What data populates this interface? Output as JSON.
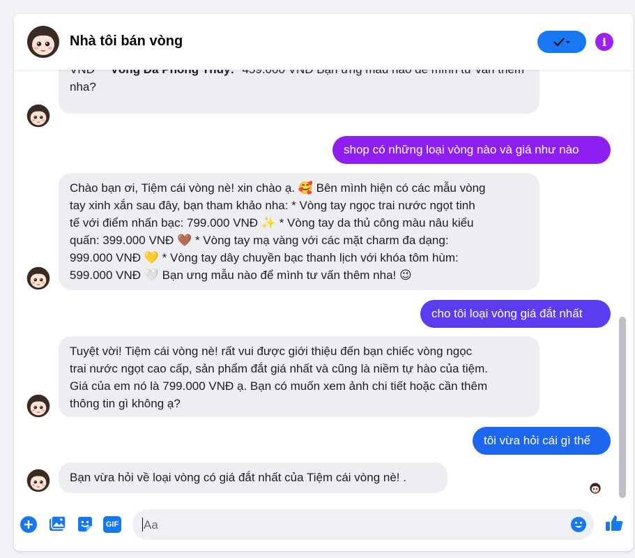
{
  "header": {
    "title": "Nhà tôi bán vòng"
  },
  "messages": [
    {
      "role": "bot",
      "parts": [
        "VNĐ *   ",
        "*Vòng Đá Phong Thủy:*",
        " 459.000 VNĐ  Bạn ưng mẫu nào để mình tư vấn thêm nha?"
      ]
    },
    {
      "role": "user",
      "text": "shop có những loại vòng nào và giá như nào"
    },
    {
      "role": "bot",
      "lines": [
        "Chào bạn ơi, Tiệm cái vòng nè! xin chào ạ. 🥰 Bên mình hiện có các mẫu vòng",
        "tay xinh xắn sau đây, bạn tham khảo nha:  *   Vòng tay ngọc trai nước ngọt tinh",
        "tế với điểm nhấn bạc: 799.000 VNĐ ✨ *   Vòng tay da thủ công màu nâu kiểu",
        "quấn: 399.000 VNĐ 🤎 *   Vòng tay mạ vàng với các mặt charm đa dạng:",
        "999.000 VNĐ 💛 *   Vòng tay dây chuyền bạc thanh lịch với khóa tôm hùm:",
        "599.000 VNĐ 🤍  Bạn ưng mẫu nào để mình tư vấn thêm nha! 😉"
      ]
    },
    {
      "role": "user",
      "text": "cho tôi loại vòng giá đắt nhất"
    },
    {
      "role": "bot",
      "lines": [
        "Tuyệt vời!  Tiệm cái vòng nè!  rất vui được giới thiệu đến bạn chiếc vòng ngọc",
        "trai nước ngọt cao cấp, sản phẩm đắt giá nhất và cũng là niềm tự hào của tiệm.",
        "Giá của em nó là 799.000 VNĐ ạ. Bạn có muốn xem ảnh chi tiết hoặc cần thêm",
        "thông tin gì không ạ?"
      ]
    },
    {
      "role": "user",
      "text": "tôi vừa hỏi cái gì thế"
    },
    {
      "role": "bot",
      "text": "Bạn vừa hỏi về loại vòng có giá đắt nhất của  Tiệm cái vòng nè! ."
    }
  ],
  "composer": {
    "placeholder": "Aa",
    "gif_label": "GIF",
    "icons": [
      "plus-icon",
      "image-icon",
      "sticker-icon",
      "gif-icon",
      "emoji-icon",
      "thumbs-up-icon"
    ]
  },
  "header_icons": [
    "checkmark-dropdown-icon",
    "info-icon"
  ],
  "colors": {
    "accent_blue": "#1877f2",
    "purple": "#a020f0",
    "bubble_gray": "#eceef1"
  }
}
